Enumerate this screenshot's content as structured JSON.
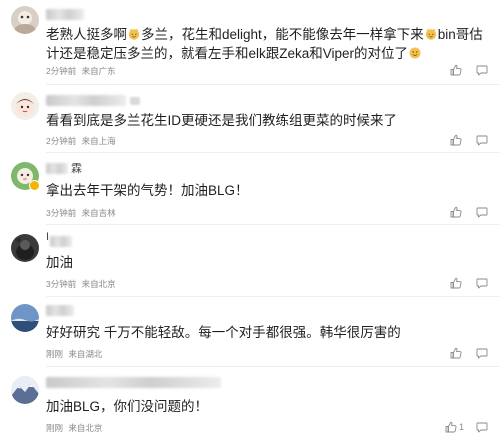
{
  "comments": [
    {
      "text_parts": [
        "老熟人挺多啊",
        "多兰，花生和delight，能不能像去年一样拿下来",
        "bin哥估计还是稳定压多兰的，就看左手和elk跟Zeka和Viper的对位了"
      ],
      "emojis": [
        "cat-face-emoji",
        "cat-face-emoji",
        "smile-emoji"
      ],
      "time": "2分钟前",
      "location": "来自广东",
      "like_count": ""
    },
    {
      "text": "看看到底是多兰花生ID更硬还是我们教练组更菜的时候来了",
      "time": "2分钟前",
      "location": "来自上海",
      "like_count": ""
    },
    {
      "name_suffix": "霖",
      "text": "拿出去年干架的气势！加油BLG！",
      "time": "3分钟前",
      "location": "来自吉林",
      "like_count": ""
    },
    {
      "text": "加油",
      "time": "3分钟前",
      "location": "来自北京",
      "like_count": ""
    },
    {
      "text": "好好研究 千万不能轻敌。每一个对手都很强。韩华很厉害的",
      "time": "刚刚",
      "location": "来自湖北",
      "like_count": ""
    },
    {
      "text": "加油BLG，你们没问题的！",
      "time": "刚刚",
      "location": "来自北京",
      "like_count": "1"
    }
  ],
  "icons": {
    "like": "thumbs-up-icon",
    "more": "more-icon"
  },
  "colors": {
    "meta": "#8a8a8a",
    "text": "#1f1f1f",
    "emoji": "#f2c14e"
  }
}
